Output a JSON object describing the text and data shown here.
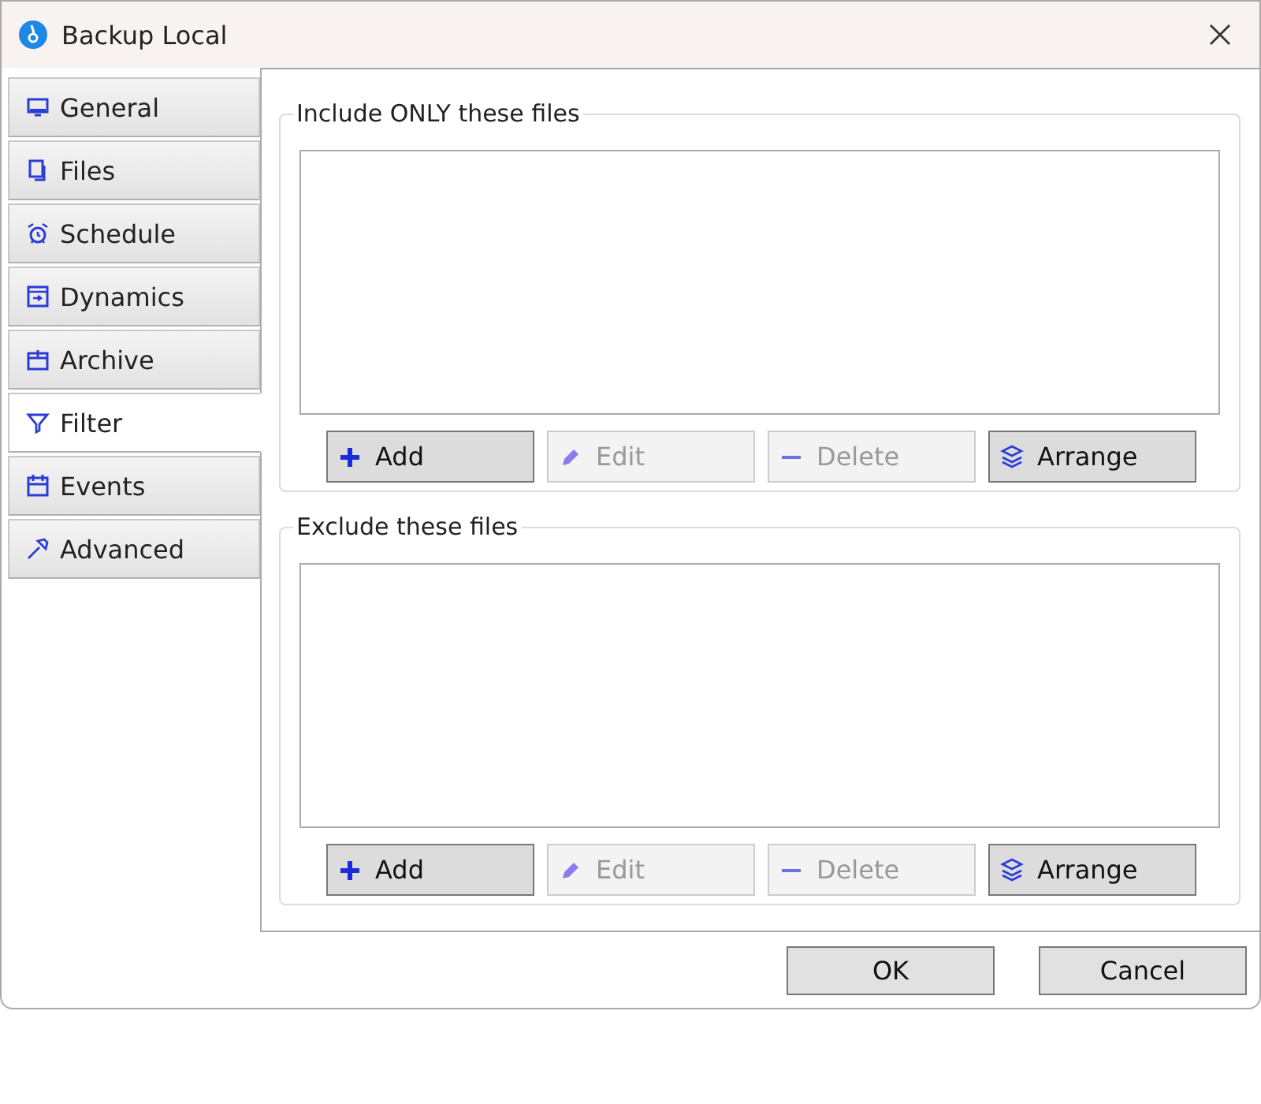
{
  "window": {
    "title": "Backup Local"
  },
  "tabs": [
    {
      "label": "General",
      "selected": false
    },
    {
      "label": "Files",
      "selected": false
    },
    {
      "label": "Schedule",
      "selected": false
    },
    {
      "label": "Dynamics",
      "selected": false
    },
    {
      "label": "Archive",
      "selected": false
    },
    {
      "label": "Filter",
      "selected": true
    },
    {
      "label": "Events",
      "selected": false
    },
    {
      "label": "Advanced",
      "selected": false
    }
  ],
  "groups": [
    {
      "title": "Include ONLY these files",
      "buttons": [
        {
          "label": "Add",
          "disabled": false
        },
        {
          "label": "Edit",
          "disabled": true
        },
        {
          "label": "Delete",
          "disabled": true
        },
        {
          "label": "Arrange",
          "disabled": false
        }
      ]
    },
    {
      "title": "Exclude these files",
      "buttons": [
        {
          "label": "Add",
          "disabled": false
        },
        {
          "label": "Edit",
          "disabled": true
        },
        {
          "label": "Delete",
          "disabled": true
        },
        {
          "label": "Arrange",
          "disabled": false
        }
      ]
    }
  ],
  "footer_buttons": [
    "OK",
    "Cancel"
  ]
}
